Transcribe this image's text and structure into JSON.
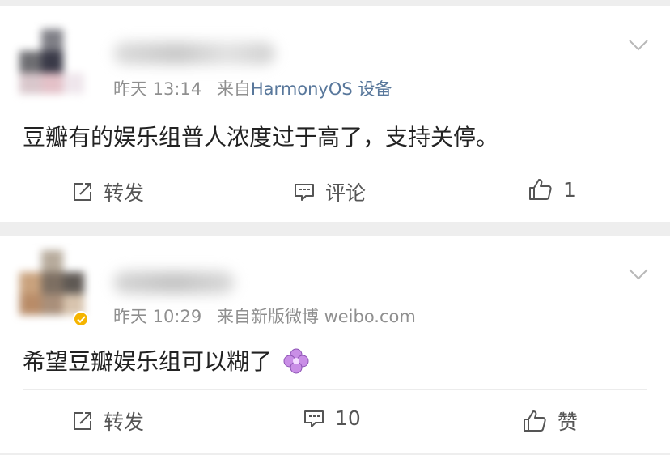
{
  "posts": [
    {
      "time": "昨天 13:14",
      "source_prefix": "来自",
      "source": "HarmonyOS 设备",
      "text": "豆瓣有的娱乐组普人浓度过于高了，支持关停。",
      "actions": {
        "forward": "转发",
        "comment": "评论",
        "like": "1"
      }
    },
    {
      "time": "昨天 10:29",
      "source_prefix": "来自",
      "source": "新版微博 weibo.com",
      "text": "希望豆瓣娱乐组可以糊了",
      "actions": {
        "forward": "转发",
        "comment": "10",
        "like": "赞"
      }
    }
  ],
  "icons": {
    "forward": "forward-icon",
    "comment": "comment-icon",
    "like": "thumbs-up-icon",
    "menu": "chevron-down-icon",
    "verified": "verified-badge-icon",
    "emoji": "flower-emoji-icon"
  },
  "colors": {
    "background": "#eeeeee",
    "card": "#ffffff",
    "text": "#222222",
    "meta": "#8f8f8f",
    "source_link": "#58779b",
    "verified": "#f5b400"
  }
}
